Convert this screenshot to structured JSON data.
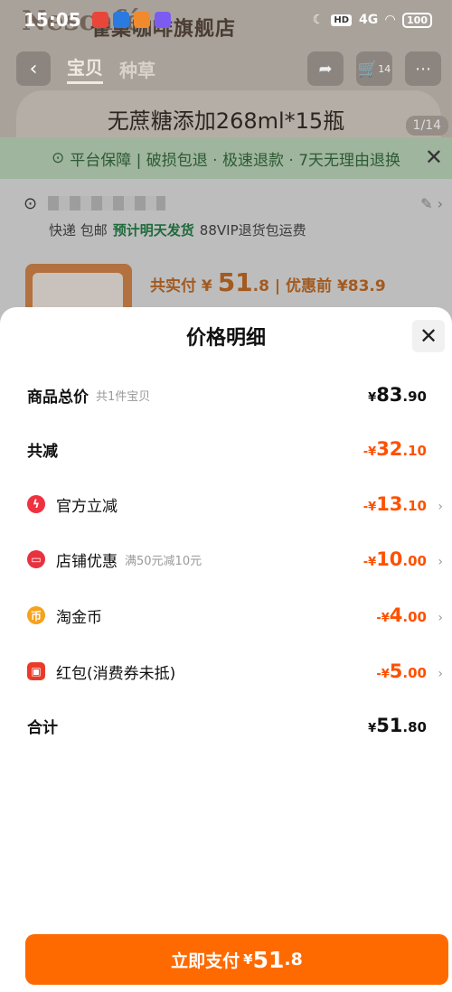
{
  "status_bar": {
    "time": "15:05",
    "network": "4G",
    "battery": "100"
  },
  "background": {
    "store_name": "雀巢咖啡旗舰店",
    "brand_logo": "Nescafé",
    "tabs": [
      "宝贝",
      "种草"
    ],
    "cart_count": "14",
    "product_title": "无蔗糖添加268ml*15瓶",
    "image_counter": "1/14",
    "guarantee": "平台保障 | 破损包退 · 极速退款 · 7天无理由退换",
    "shipping": {
      "method": "快递 包邮",
      "ship_time": "预计明天发货",
      "vip": "88VIP退货包运费"
    },
    "summary": {
      "label": "共实付",
      "cur": "¥",
      "int": "51",
      "dec": ".8",
      "pre_label": "| 优惠前",
      "pre_price": "¥83.9"
    }
  },
  "sheet": {
    "title": "价格明细",
    "rows": [
      {
        "label": "商品总价",
        "sub": "共1件宝贝",
        "cur": "¥",
        "int": "83",
        "dec": ".90"
      },
      {
        "label": "共减",
        "cur": "-¥",
        "int": "32",
        "dec": ".10"
      },
      {
        "label": "官方立减",
        "cur": "-¥",
        "int": "13",
        "dec": ".10"
      },
      {
        "label": "店铺优惠",
        "sub": "满50元减10元",
        "cur": "-¥",
        "int": "10",
        "dec": ".00"
      },
      {
        "label": "淘金币",
        "cur": "-¥",
        "int": "4",
        "dec": ".00"
      },
      {
        "label": "红包(消费券未抵)",
        "cur": "-¥",
        "int": "5",
        "dec": ".00"
      },
      {
        "label": "合计",
        "cur": "¥",
        "int": "51",
        "dec": ".80"
      }
    ],
    "pay_button": {
      "label": "立即支付",
      "cur": "¥",
      "int": "51",
      "dec": ".8"
    }
  },
  "colors": {
    "accent_orange": "#ff5000",
    "button_orange": "#ff6a00"
  },
  "icons": [
    "bolt-icon",
    "shop-icon",
    "coin-icon",
    "red-packet-icon",
    "close-icon",
    "chevron-right-icon"
  ]
}
